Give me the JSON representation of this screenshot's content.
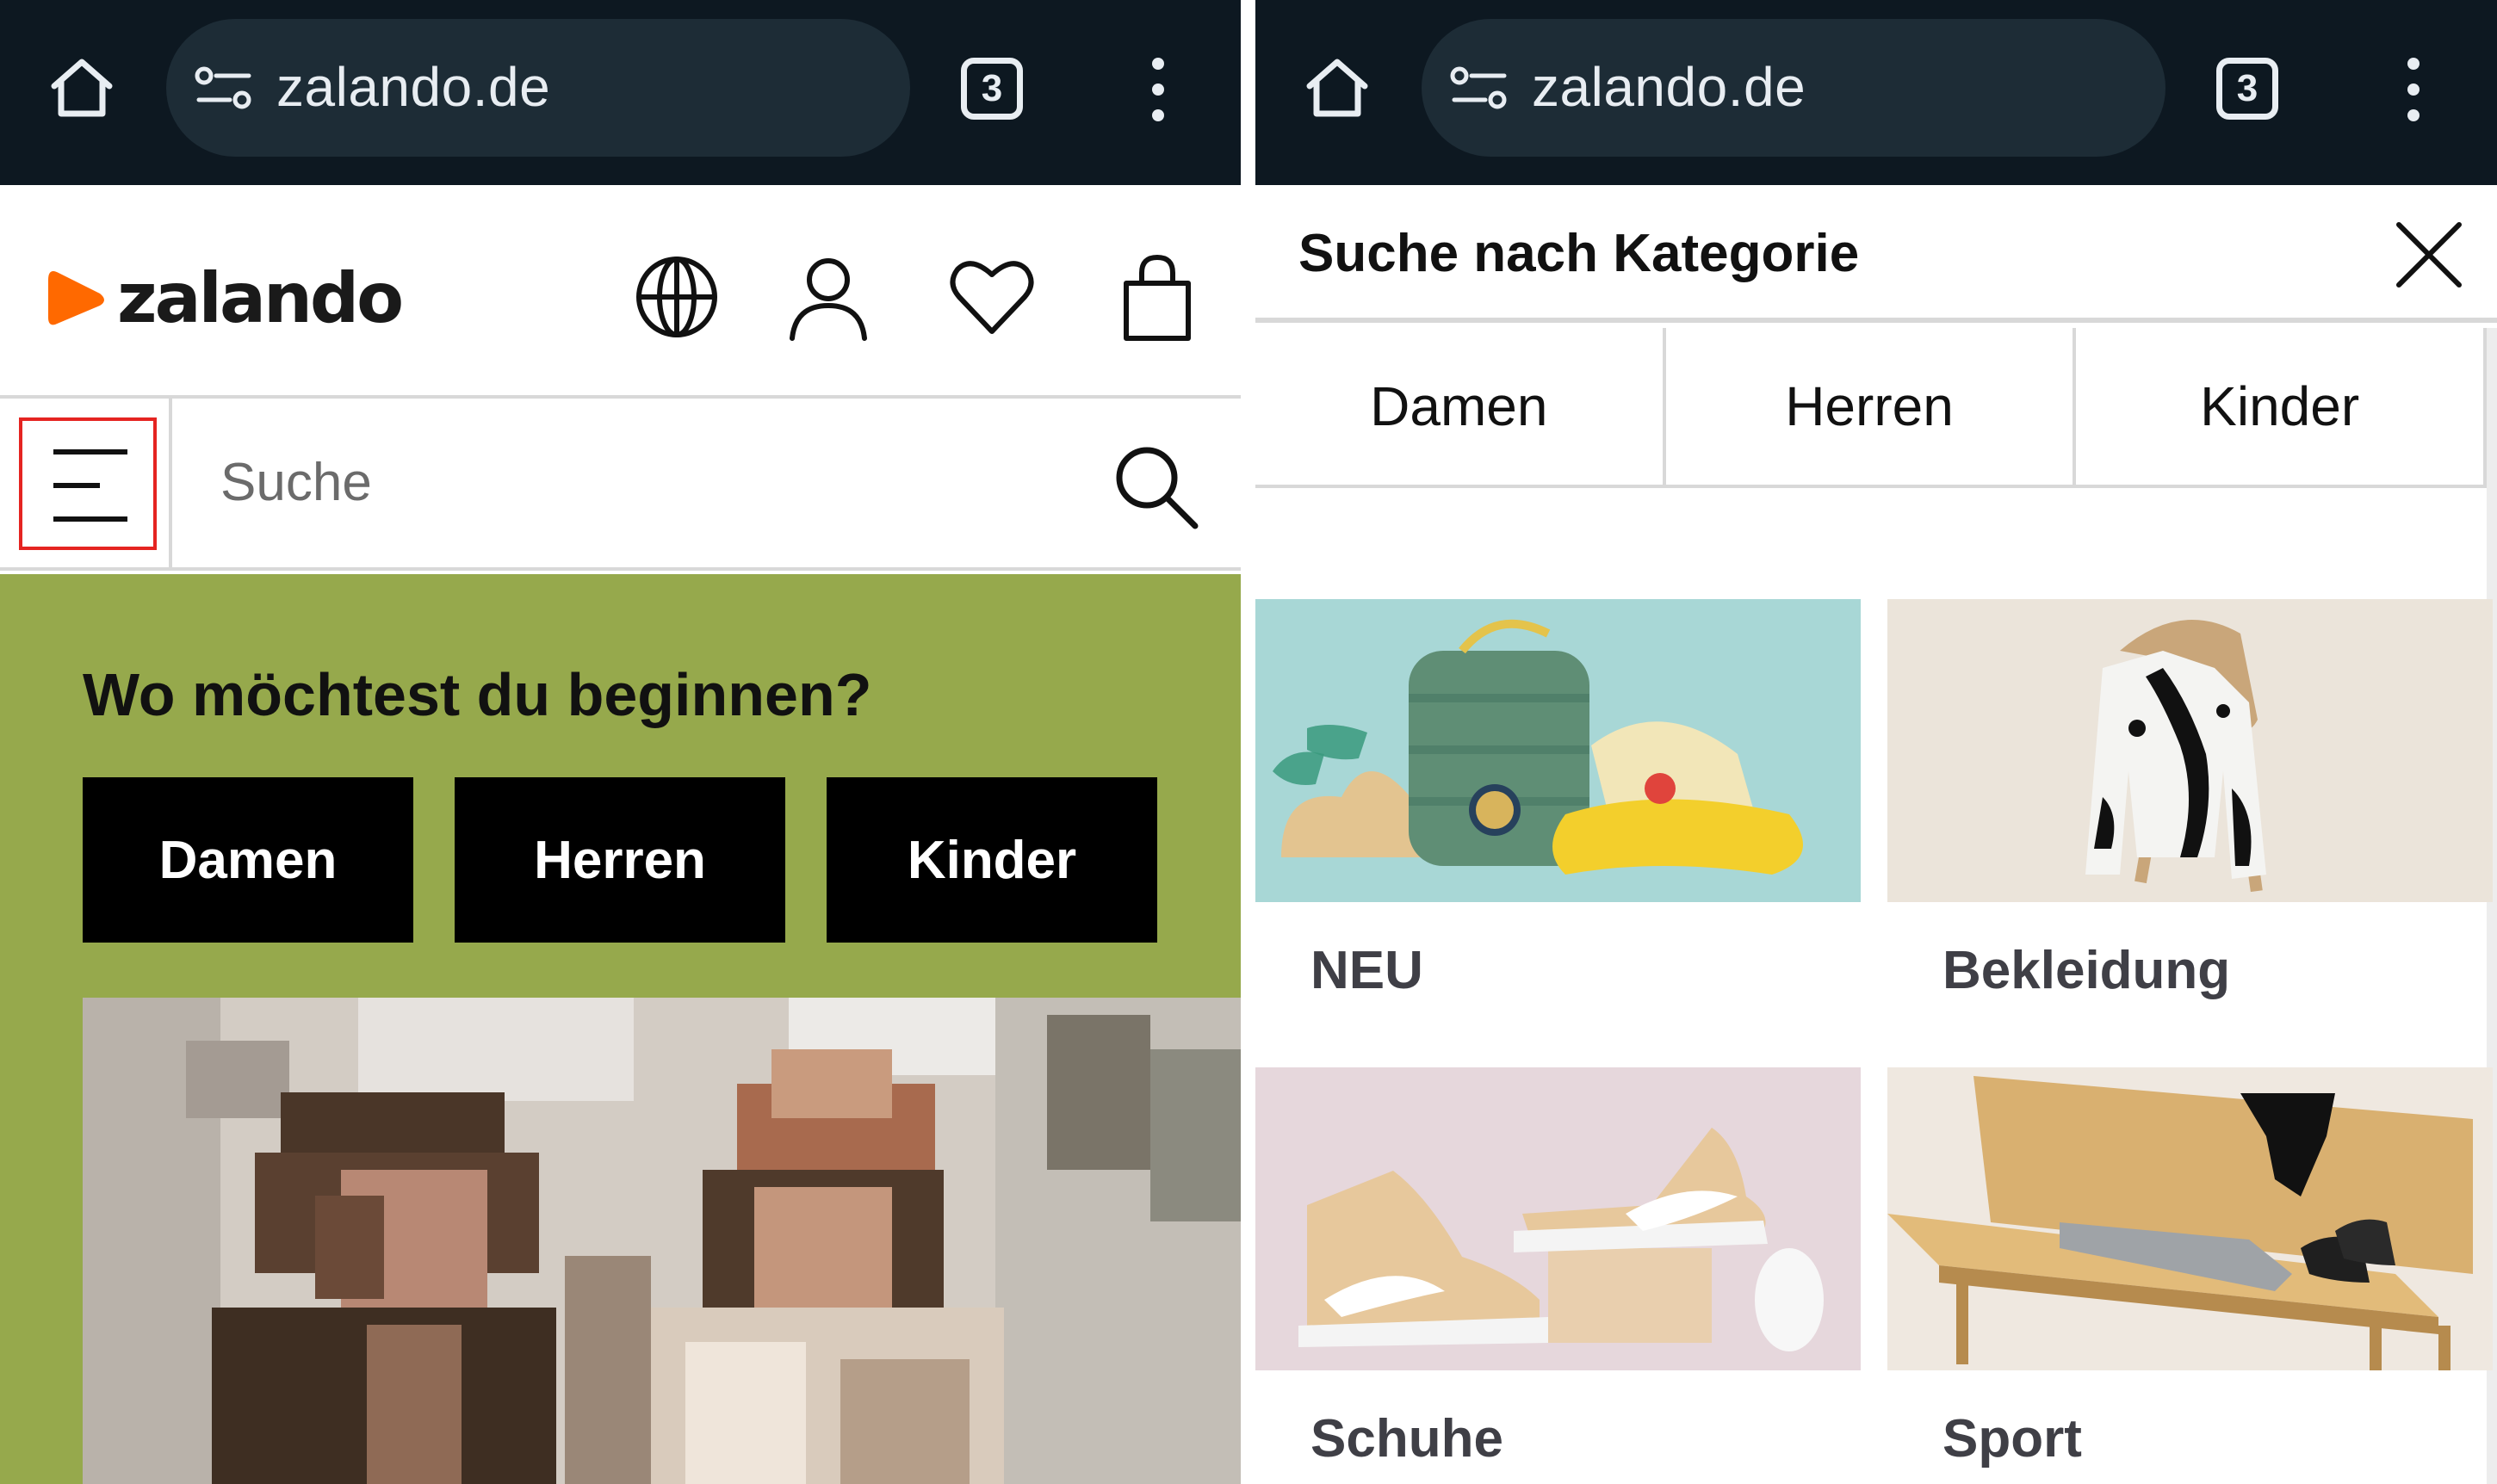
{
  "left": {
    "browser": {
      "url": "zalando.de",
      "tab_count": "3",
      "icons": [
        "home-icon",
        "site-settings-icon",
        "tab-switcher-icon",
        "kebab-menu-icon"
      ]
    },
    "header": {
      "logo_text": "zalando",
      "brand_color": "#ff6900",
      "icons": [
        "globe-icon",
        "user-icon",
        "heart-icon",
        "shopping-bag-icon"
      ]
    },
    "search": {
      "placeholder": "Suche",
      "highlight_color": "#e52421"
    },
    "promo": {
      "background": "#96a94c",
      "question": "Wo möchtest du beginnen?",
      "buttons": [
        "Damen",
        "Herren",
        "Kinder"
      ]
    }
  },
  "right": {
    "browser": {
      "url": "zalando.de",
      "tab_count": "3"
    },
    "panel": {
      "title": "Suche nach Kategorie",
      "close_icon": "close-icon"
    },
    "tabs": [
      "Damen",
      "Herren",
      "Kinder"
    ],
    "categories": [
      {
        "label": "NEU"
      },
      {
        "label": "Bekleidung"
      },
      {
        "label": "Schuhe"
      },
      {
        "label": "Sport"
      }
    ]
  }
}
